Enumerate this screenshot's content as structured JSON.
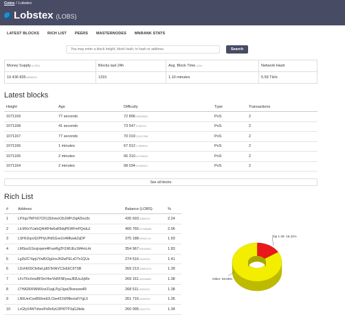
{
  "breadcrumb": {
    "root": "Coins",
    "sep": "/",
    "current": "Lobstex"
  },
  "header": {
    "title": "Lobstex",
    "ticker": "(LOBS)"
  },
  "nav": [
    "LATEST BLOCKS",
    "RICH LIST",
    "PEERS",
    "MASTERNODES",
    "MNRANK STATS"
  ],
  "search": {
    "placeholder": "You may enter a block height, block hash, tx hash or address.",
    "button": "Search"
  },
  "summary": {
    "money_supply_label": "Money Supply",
    "money_supply_unit": "(LOBS)",
    "money_supply_main": "19 436 835",
    ".money_supply_sub": "",
    "money_supply_dec": ".86586023",
    "blocks_label": "Blocks last 24h",
    "blocks_value": "1315",
    "blocktime_label": "Avg. Block Time",
    "blocktime_unit": "(24h)",
    "blocktime_value": "1.10 minutes",
    "hash_label": "Network Hash",
    "hash_value": "5.59 TH/s"
  },
  "latest_blocks": {
    "heading": "Latest blocks",
    "columns": [
      "Height",
      "Age",
      "Difficulty",
      "Type",
      "Transactions"
    ],
    "rows": [
      {
        "height": "1071169",
        "age": "77 seconds",
        "diff": "72 896",
        "diff_dec": ".256528803",
        "type": "PoS",
        "tx": "2"
      },
      {
        "height": "1071168",
        "age": "41 seconds",
        "diff": "73 547",
        "diff_dec": ".67560791",
        "type": "PoS",
        "tx": "2"
      },
      {
        "height": "1071167",
        "age": "77 seconds",
        "diff": "70 019",
        "diff_dec": ".103017956",
        "type": "PoS",
        "tx": "2"
      },
      {
        "height": "1071166",
        "age": "1 minutes",
        "diff": "67 912",
        "diff_dec": ".174805091",
        "type": "PoS",
        "tx": "2"
      },
      {
        "height": "1071165",
        "age": "2 minutes",
        "diff": "66 310",
        "diff_dec": ".047264094",
        "type": "PoS",
        "tx": "2"
      },
      {
        "height": "1071164",
        "age": "2 minutes",
        "diff": "68 034",
        "diff_dec": ".914545437",
        "type": "PoS",
        "tx": "2"
      }
    ],
    "see_all": "See all blocks"
  },
  "rich_list": {
    "heading": "Rich List",
    "columns": [
      "#",
      "Address",
      "Balance (LOBS)",
      "%"
    ],
    "rows": [
      {
        "n": "1",
        "addr": "LPXqsTNPX67CR12EhnwX2bJWPc5qADioz9c",
        "bal": "435 693",
        ".dec": "",
        "dec": ".46860000",
        "pct": "2.24"
      },
      {
        "n": "2",
        "addr": "LiLMXsYUafoQ4nf6Hw6aR5dqPEWFmPQxduJ",
        "bal": "400 765",
        "dec": ".674488986",
        "pct": "2.06"
      },
      {
        "n": "3",
        "addr": "LSHh1kpxXjVPHyUHdSGve2x4MfuwkZqDP",
        "bal": "375 188",
        "dec": ".559621 50",
        "pct": "1.93"
      },
      {
        "n": "4",
        "addr": "LMSezGSnzjrqwm4lFuwRgZH1WUEs1M4mL4z",
        "bal": "354 967",
        "dec": ".895408641",
        "pct": "1.83"
      },
      {
        "n": "5",
        "addr": "Lg2b2CYqqUYwBX3gUnxJN2wPELxDTn1QUz",
        "bal": "274 516",
        "dec": ".00000000",
        "pct": "1.41"
      },
      {
        "n": "6",
        "addr": "LDzhK6SCfe6wLjdtSTe9kVC3xEEC6TSB",
        "bal": "269 213",
        "dec": ".308815479",
        "pct": "1.39"
      },
      {
        "n": "7",
        "addr": "LFvTKnXmsBF9nV4erVkRFNFpsuJ83UuJqWo",
        "bal": "269 161",
        "dec": ".063048662",
        "pct": "1.38"
      },
      {
        "n": "8",
        "addr": "LTHA28XNNMXos31sgLPgJJgatJ9seuww4R",
        "bal": "268 511",
        "dec": ".00000000",
        "pct": "1.38"
      },
      {
        "n": "9",
        "addr": "LN5UmCoeB56mdi2LCbe421W9BectsFiYgL5",
        "bal": "261 716",
        "dec": ".00000000",
        "pct": "1.35"
      },
      {
        "n": "10",
        "addr": "LcGfyX4W7xbeoPsRe5zU3PKfTPJqGJikda",
        "bal": "260 995",
        "dec": ".18347972",
        "pct": "1.34"
      }
    ]
  },
  "chart_data": {
    "type": "pie",
    "slices": [
      {
        "label": "Top 1-25",
        "value": 16.31,
        "text": "Top 1-25- 16.31%",
        "color": "#e8181b"
      },
      {
        "label": "Other",
        "value": 83.69,
        "text": "Other- 83.69%",
        "color": "#f3ee00"
      }
    ]
  }
}
